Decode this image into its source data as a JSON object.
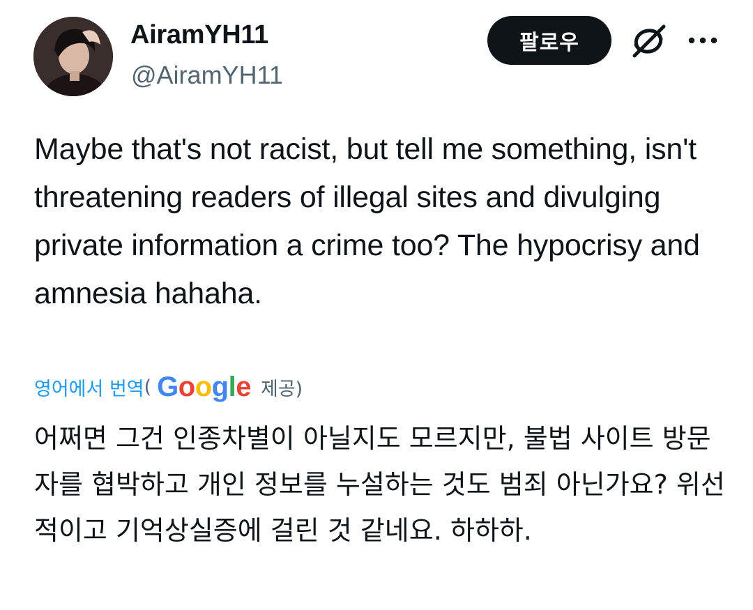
{
  "author": {
    "display_name": "AiramYH11",
    "handle": "@AiramYH11",
    "avatar_icon": "profile-photo"
  },
  "actions": {
    "follow_label": "팔로우",
    "grok_icon": "grok-icon",
    "more_icon": "more-options-icon"
  },
  "tweet": {
    "text": "Maybe that's not racist, but tell me something, isn't threatening  readers of illegal sites and divulging private information a crime too? The hypocrisy and amnesia hahaha.",
    "translation": {
      "link_label": "영어에서 번역",
      "paren_open": "(",
      "provider_letters": [
        "G",
        "o",
        "o",
        "g",
        "l",
        "e"
      ],
      "provided_label": "제공)",
      "text": "어쩌면 그건 인종차별이 아닐지도 모르지만, 불법 사이트 방문자를 협박하고 개인 정보를 누설하는 것도 범죄 아닌가요? 위선적이고 기억상실증에 걸린 것 같네요. 하하하."
    }
  },
  "colors": {
    "text_primary": "#0f1419",
    "text_secondary": "#536471",
    "link_blue": "#1d9bf0",
    "google_blue": "#4285f4",
    "google_red": "#ea4335",
    "google_yellow": "#fbbc05",
    "google_green": "#34a853"
  }
}
